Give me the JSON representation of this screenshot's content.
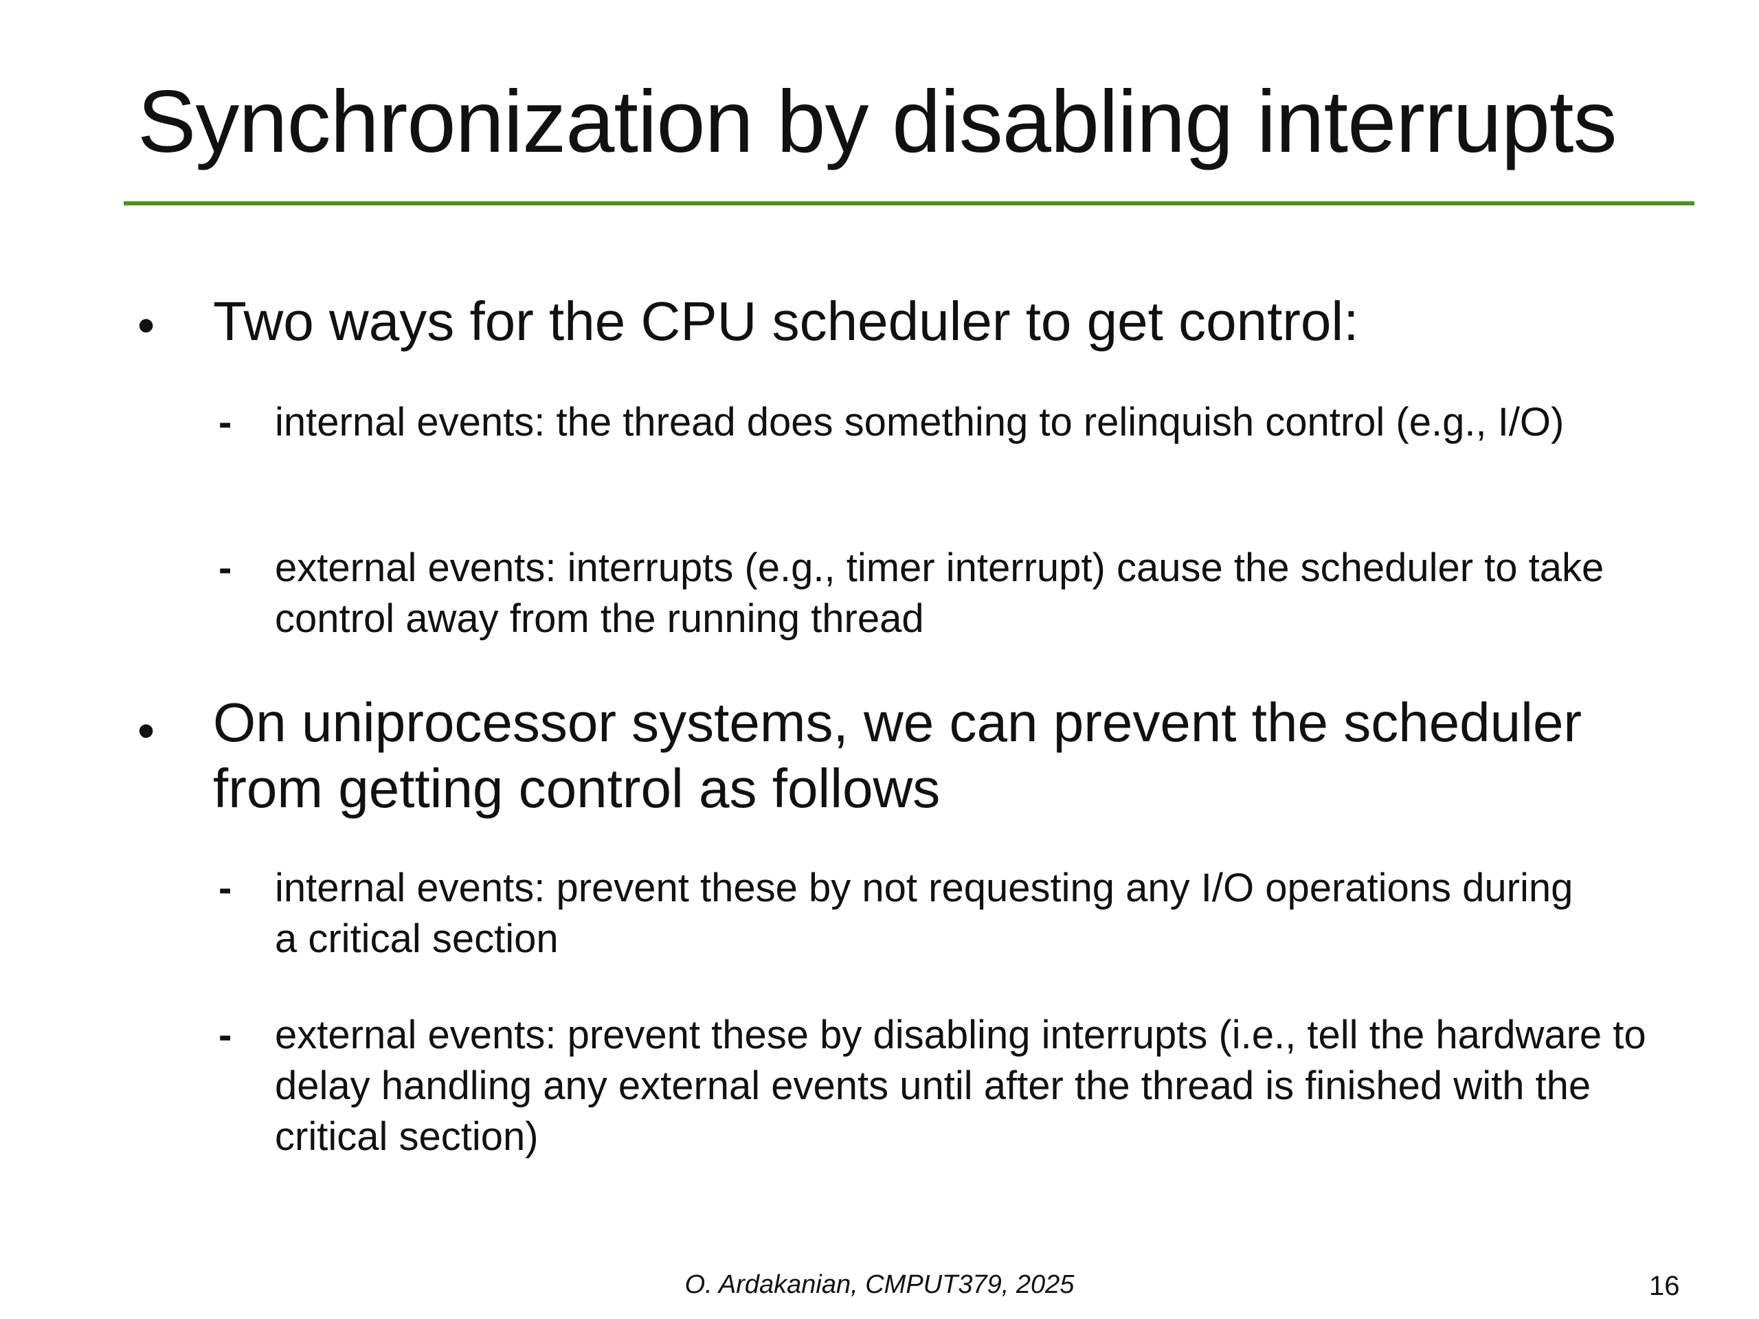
{
  "slide": {
    "title": "Synchronization by disabling interrupts",
    "accent_color": "#4e9221",
    "bullet_glyph": "•",
    "dash_glyph": "-",
    "bullets": [
      {
        "text": "Two ways for the CPU scheduler to get control:",
        "subitems": [
          "internal events: the thread does something to relinquish control (e.g., I/O)",
          "external events: interrupts (e.g., timer interrupt) cause the scheduler to take control away from the running thread"
        ]
      },
      {
        "text": "On uniprocessor systems, we can prevent the scheduler from getting control as follows",
        "subitems": [
          "internal events: prevent these by not requesting any I/O operations during a critical section",
          "external events: prevent these by disabling interrupts (i.e., tell the hardware to delay handling any external events until after the thread is finished with the critical section)"
        ]
      }
    ]
  },
  "footer": {
    "credit": "O. Ardakanian, CMPUT379, 2025",
    "page_number": "16"
  }
}
